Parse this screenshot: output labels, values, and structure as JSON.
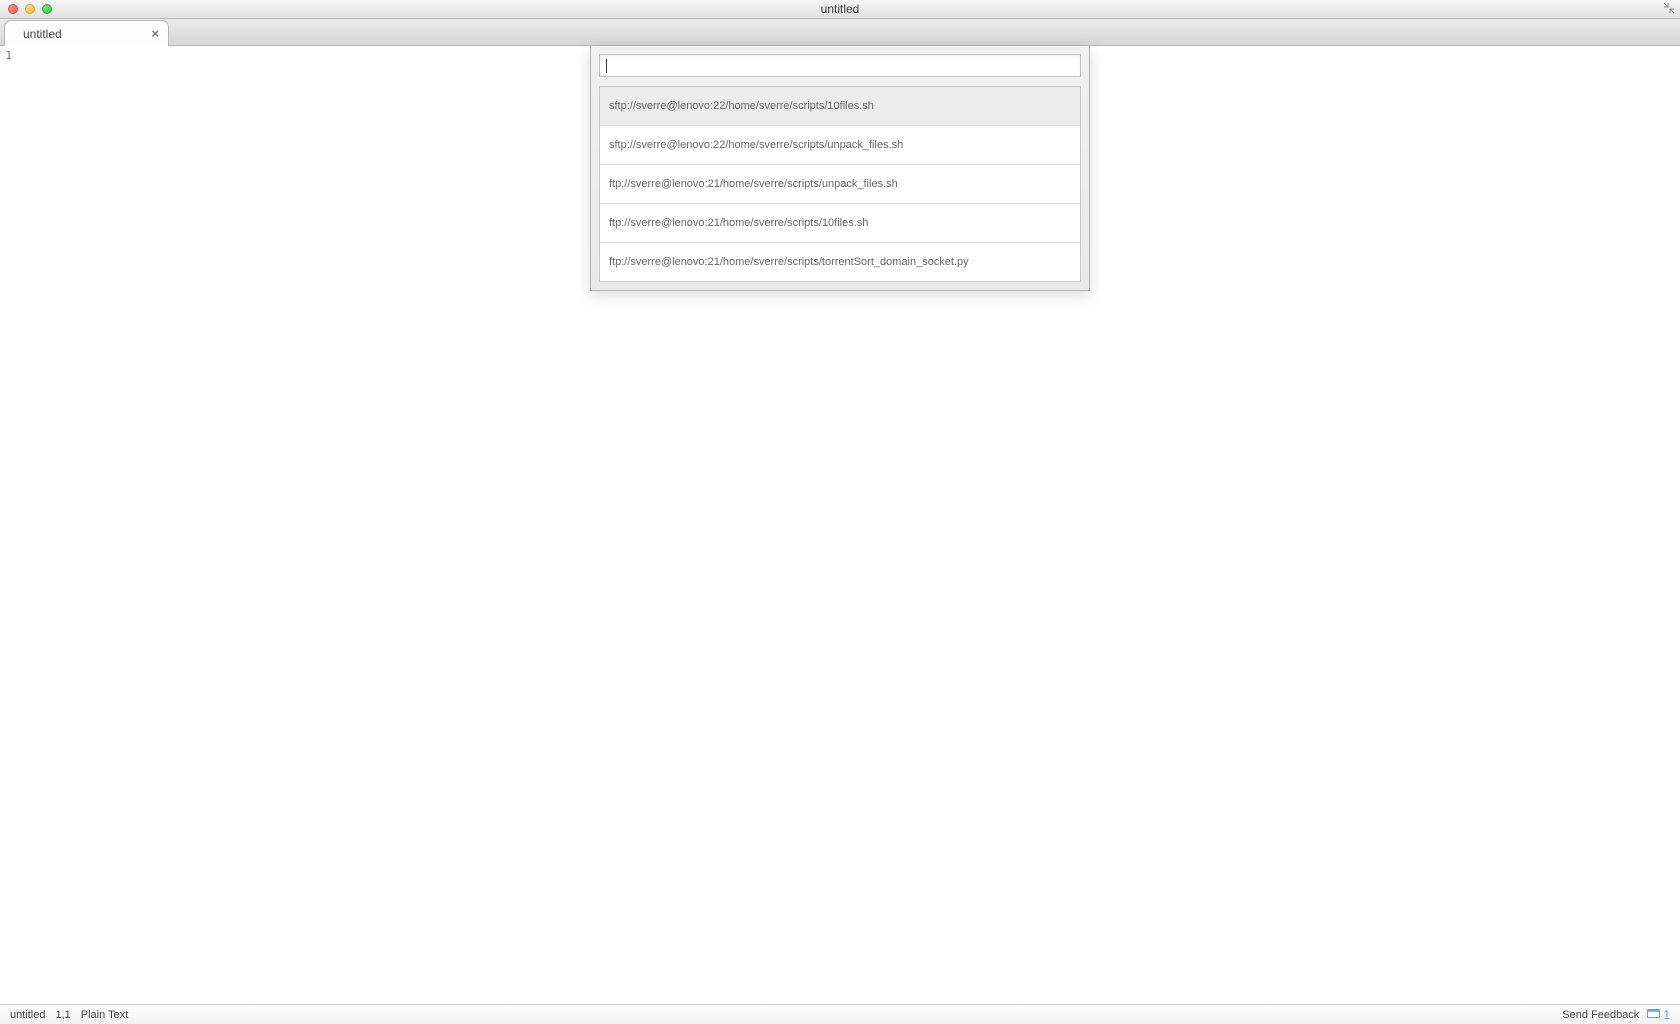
{
  "window": {
    "title": "untitled"
  },
  "tabs": [
    {
      "label": "untitled"
    }
  ],
  "gutter": {
    "line1": "1"
  },
  "quick_open": {
    "input_value": "",
    "results": [
      "sftp://sverre@lenovo:22/home/sverre/scripts/10files.sh",
      "sftp://sverre@lenovo:22/home/sverre/scripts/unpack_files.sh",
      "ftp://sverre@lenovo:21/home/sverre/scripts/unpack_files.sh",
      "ftp://sverre@lenovo:21/home/sverre/scripts/10files.sh",
      "ftp://sverre@lenovo:21/home/sverre/scripts/torrentSort_domain_socket.py"
    ]
  },
  "status": {
    "filename": "untitled",
    "position": "1,1",
    "syntax": "Plain Text",
    "feedback_label": "Send Feedback",
    "notif_count": "1"
  }
}
